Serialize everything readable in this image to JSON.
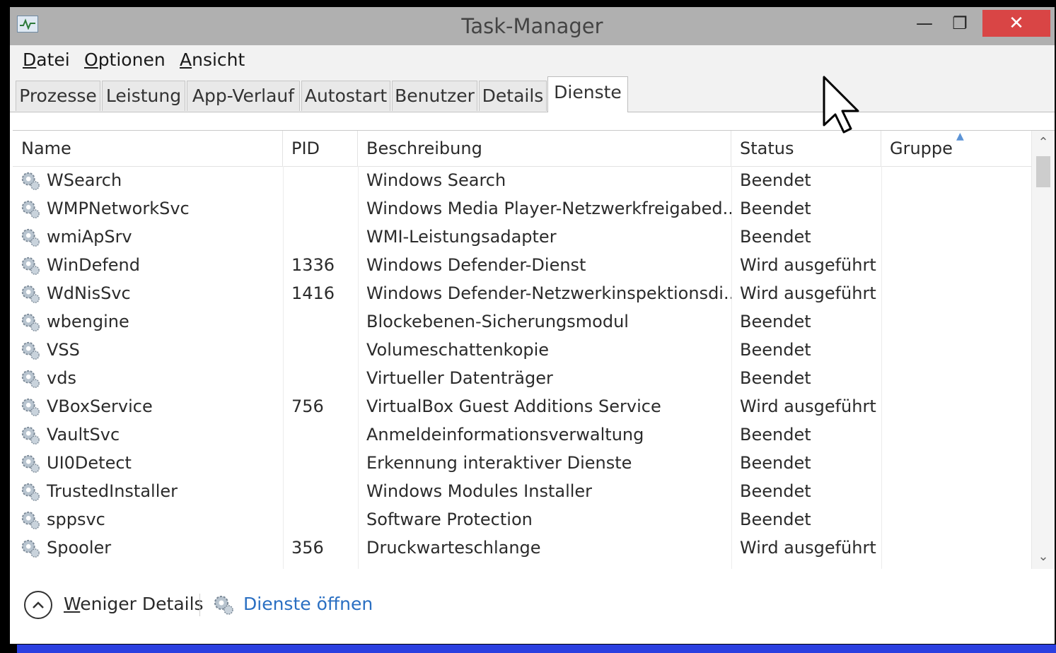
{
  "window": {
    "title": "Task-Manager"
  },
  "menu": [
    {
      "underline": "D",
      "rest": "atei"
    },
    {
      "underline": "O",
      "rest": "ptionen"
    },
    {
      "underline": "A",
      "rest": "nsicht"
    }
  ],
  "tabs": [
    "Prozesse",
    "Leistung",
    "App-Verlauf",
    "Autostart",
    "Benutzer",
    "Details",
    "Dienste"
  ],
  "active_tab": "Dienste",
  "columns": [
    "Name",
    "PID",
    "Beschreibung",
    "Status",
    "Gruppe"
  ],
  "rows": [
    {
      "name": "WSearch",
      "pid": "",
      "desc": "Windows Search",
      "status": "Beendet",
      "group": ""
    },
    {
      "name": "WMPNetworkSvc",
      "pid": "",
      "desc": "Windows Media Player-Netzwerkfreigabed...",
      "status": "Beendet",
      "group": ""
    },
    {
      "name": "wmiApSrv",
      "pid": "",
      "desc": "WMI-Leistungsadapter",
      "status": "Beendet",
      "group": ""
    },
    {
      "name": "WinDefend",
      "pid": "1336",
      "desc": "Windows Defender-Dienst",
      "status": "Wird ausgeführt",
      "group": ""
    },
    {
      "name": "WdNisSvc",
      "pid": "1416",
      "desc": "Windows Defender-Netzwerkinspektionsdi...",
      "status": "Wird ausgeführt",
      "group": ""
    },
    {
      "name": "wbengine",
      "pid": "",
      "desc": "Blockebenen-Sicherungsmodul",
      "status": "Beendet",
      "group": ""
    },
    {
      "name": "VSS",
      "pid": "",
      "desc": "Volumeschattenkopie",
      "status": "Beendet",
      "group": ""
    },
    {
      "name": "vds",
      "pid": "",
      "desc": "Virtueller Datenträger",
      "status": "Beendet",
      "group": ""
    },
    {
      "name": "VBoxService",
      "pid": "756",
      "desc": "VirtualBox Guest Additions Service",
      "status": "Wird ausgeführt",
      "group": ""
    },
    {
      "name": "VaultSvc",
      "pid": "",
      "desc": "Anmeldeinformationsverwaltung",
      "status": "Beendet",
      "group": ""
    },
    {
      "name": "UI0Detect",
      "pid": "",
      "desc": "Erkennung interaktiver Dienste",
      "status": "Beendet",
      "group": ""
    },
    {
      "name": "TrustedInstaller",
      "pid": "",
      "desc": "Windows Modules Installer",
      "status": "Beendet",
      "group": ""
    },
    {
      "name": "sppsvc",
      "pid": "",
      "desc": "Software Protection",
      "status": "Beendet",
      "group": ""
    },
    {
      "name": "Spooler",
      "pid": "356",
      "desc": "Druckwarteschlange",
      "status": "Wird ausgeführt",
      "group": ""
    }
  ],
  "footer": {
    "less_details_underline": "W",
    "less_details_rest": "eniger Details",
    "open_services": "Dienste öffnen"
  },
  "icons": {
    "service": "gear-icon",
    "collapse": "chevron-up-circle-icon",
    "app": "task-manager-icon"
  },
  "colors": {
    "titlebar": "#b0b0b0",
    "close": "#d94545",
    "link": "#2a6fc2",
    "bottom_bar": "#2b3fe0"
  }
}
